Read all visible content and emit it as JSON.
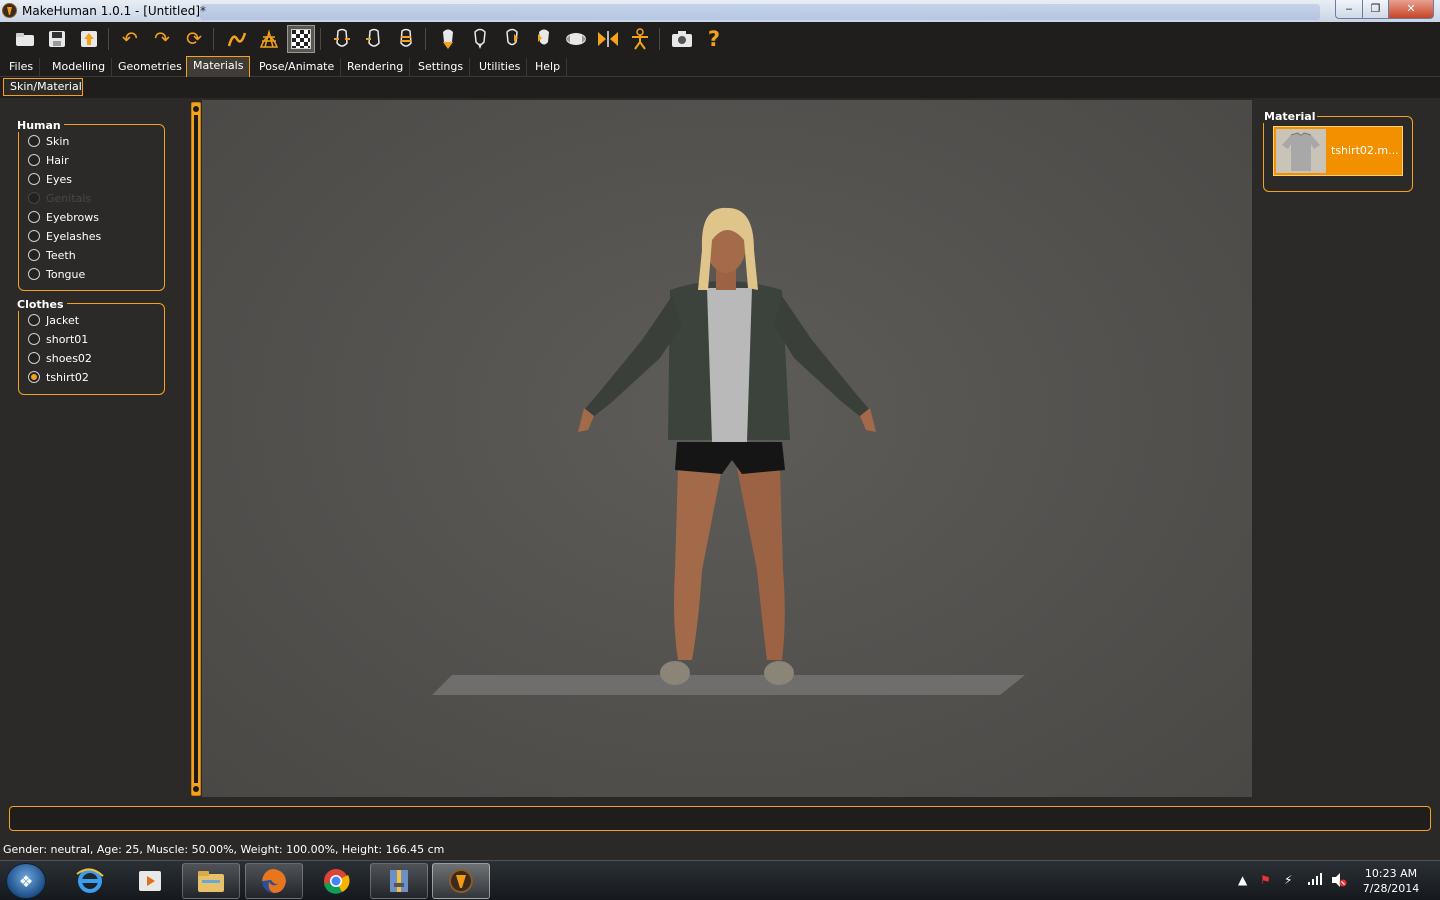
{
  "window": {
    "title": "MakeHuman 1.0.1 - [Untitled]*",
    "controls": {
      "minimize": "‒",
      "maximize": "❐",
      "close": "✕"
    }
  },
  "toolbar": {
    "icons": [
      "open-file-icon",
      "save-icon",
      "export-icon",
      "undo-icon",
      "redo-icon",
      "reset-icon",
      "smooth-icon",
      "wireframe-icon",
      "background-icon",
      "front-view-icon",
      "back-view-icon",
      "left-view-icon",
      "right-view-icon",
      "top-view-icon",
      "bottom-view-icon",
      "reset-camera-icon",
      "pose-icon",
      "screenshot-icon",
      "help-icon"
    ]
  },
  "tabs": {
    "items": [
      "Files",
      "Modelling",
      "Geometries",
      "Materials",
      "Pose/Animate",
      "Rendering",
      "Settings",
      "Utilities",
      "Help"
    ],
    "active": "Materials"
  },
  "subtabs": {
    "active_label": "Skin/Material"
  },
  "human_group": {
    "title": "Human",
    "items": [
      "Skin",
      "Hair",
      "Eyes",
      "Genitals",
      "Eyebrows",
      "Eyelashes",
      "Teeth",
      "Tongue"
    ],
    "disabled": "Genitals"
  },
  "clothes_group": {
    "title": "Clothes",
    "items": [
      "Jacket",
      "short01",
      "shoes02",
      "tshirt02"
    ],
    "selected": "tshirt02"
  },
  "material_panel": {
    "title": "Material",
    "selected_label": "tshirt02.m..."
  },
  "progress": {
    "fraction": 0
  },
  "status": {
    "text": "Gender: neutral, Age: 25, Muscle: 50.00%, Weight: 100.00%, Height: 166.45 cm"
  },
  "taskbar": {
    "apps": [
      "internet-explorer-icon",
      "media-player-icon",
      "file-explorer-icon",
      "firefox-icon",
      "chrome-icon",
      "archive-icon",
      "makehuman-icon"
    ],
    "time": "10:23 AM",
    "date": "7/28/2014"
  },
  "colors": {
    "accent": "#f4a21b",
    "panel": "#2b2a28",
    "viewport": "#555350"
  }
}
